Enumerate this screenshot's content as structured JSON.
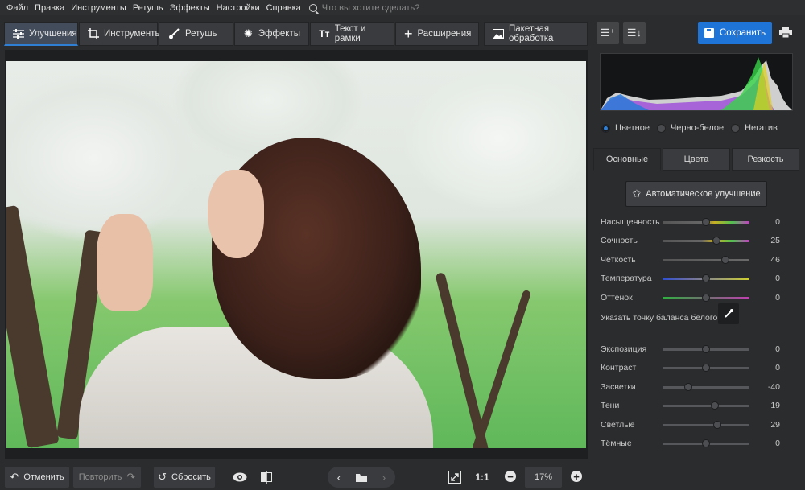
{
  "menu": [
    "Файл",
    "Правка",
    "Инструменты",
    "Ретушь",
    "Эффекты",
    "Настройки",
    "Справка"
  ],
  "search": {
    "placeholder": "Что вы хотите сделать?"
  },
  "tabs": [
    {
      "label": "Улучшения",
      "icon": "sliders-icon",
      "active": true
    },
    {
      "label": "Инструменты",
      "icon": "crop-icon"
    },
    {
      "label": "Ретушь",
      "icon": "brush-icon"
    },
    {
      "label": "Эффекты",
      "icon": "magic-wand-icon"
    },
    {
      "label": "Текст и рамки",
      "icon": "text-icon"
    },
    {
      "label": "Расширения",
      "icon": "plus-icon"
    }
  ],
  "batch_label": "Пакетная обработка",
  "save_label": "Сохранить",
  "color_mode": {
    "options": [
      "Цветное",
      "Черно-белое",
      "Негатив"
    ],
    "selected": "Цветное"
  },
  "subtabs": [
    "Основные",
    "Цвета",
    "Резкость"
  ],
  "auto_label": "Автоматическое улучшение",
  "sliders_color": [
    {
      "label": "Насыщенность",
      "value": "0",
      "pos": 0.5
    },
    {
      "label": "Сочность",
      "value": "25",
      "pos": 0.62
    },
    {
      "label": "Чёткость",
      "value": "46",
      "pos": 0.72
    },
    {
      "label": "Температура",
      "value": "0",
      "pos": 0.5
    },
    {
      "label": "Оттенок",
      "value": "0",
      "pos": 0.5
    }
  ],
  "white_balance_label": "Указать точку баланса белого",
  "sliders_light": [
    {
      "label": "Экспозиция",
      "value": "0",
      "pos": 0.5
    },
    {
      "label": "Контраст",
      "value": "0",
      "pos": 0.5
    },
    {
      "label": "Засветки",
      "value": "-40",
      "pos": 0.3
    },
    {
      "label": "Тени",
      "value": "19",
      "pos": 0.6
    },
    {
      "label": "Светлые",
      "value": "29",
      "pos": 0.63
    },
    {
      "label": "Тёмные",
      "value": "0",
      "pos": 0.5
    }
  ],
  "bottom": {
    "undo": "Отменить",
    "redo": "Повторить",
    "reset": "Сбросить",
    "ratio": "1:1",
    "zoom": "17%"
  },
  "colors": {
    "accent": "#1f74d8",
    "panel": "#2b2c2e"
  }
}
